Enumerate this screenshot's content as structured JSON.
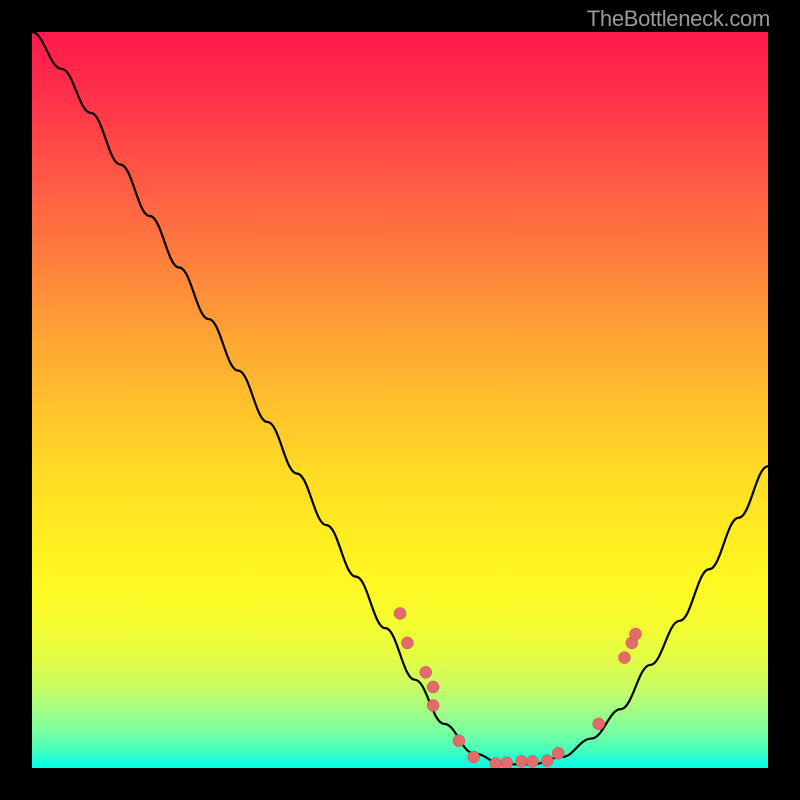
{
  "watermark": {
    "text": "TheBottleneck.com"
  },
  "colors": {
    "curve": "#000000",
    "marker_fill": "#e36b6b",
    "marker_stroke": "#c94f4f"
  },
  "chart_data": {
    "type": "line",
    "title": "",
    "xlabel": "",
    "ylabel": "",
    "xlim": [
      0,
      100
    ],
    "ylim": [
      0,
      100
    ],
    "grid": false,
    "legend": false,
    "series": [
      {
        "name": "bottleneck-curve",
        "x": [
          0,
          4,
          8,
          12,
          16,
          20,
          24,
          28,
          32,
          36,
          40,
          44,
          48,
          52,
          56,
          60,
          64,
          68,
          72,
          76,
          80,
          84,
          88,
          92,
          96,
          100
        ],
        "y": [
          100,
          95,
          89,
          82,
          75,
          68,
          61,
          54,
          47,
          40,
          33,
          26,
          19,
          12,
          6,
          2,
          0.5,
          0.5,
          1.5,
          4,
          8,
          14,
          20,
          27,
          34,
          41
        ]
      }
    ],
    "markers": {
      "name": "data-points",
      "x": [
        50,
        51,
        53.5,
        54.5,
        54.5,
        58,
        60,
        63,
        64.5,
        66.5,
        68,
        70,
        71.5,
        77,
        80.5,
        81.5,
        82
      ],
      "y": [
        21,
        17,
        13,
        11,
        8.5,
        3.7,
        1.5,
        0.6,
        0.7,
        0.9,
        0.9,
        1.0,
        2.0,
        6.0,
        15,
        17,
        18.2
      ]
    }
  }
}
